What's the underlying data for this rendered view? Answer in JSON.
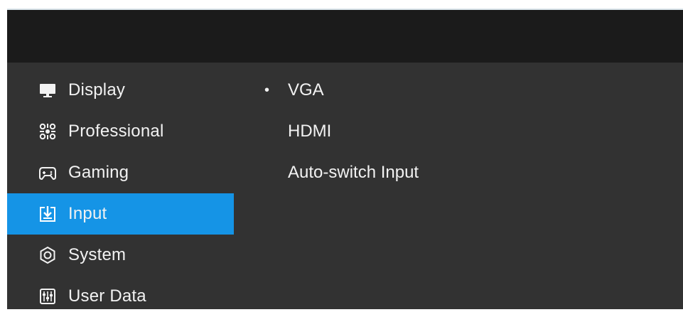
{
  "sidebar": {
    "items": [
      {
        "label": "Display",
        "icon": "monitor-icon"
      },
      {
        "label": "Professional",
        "icon": "professional-icon"
      },
      {
        "label": "Gaming",
        "icon": "gamepad-icon"
      },
      {
        "label": "Input",
        "icon": "input-icon",
        "active": true
      },
      {
        "label": "System",
        "icon": "system-icon"
      },
      {
        "label": "User Data",
        "icon": "user-data-icon"
      }
    ]
  },
  "options": {
    "selected_marker": "•",
    "items": [
      {
        "label": "VGA",
        "selected": true
      },
      {
        "label": "HDMI",
        "selected": false
      },
      {
        "label": "Auto-switch Input",
        "selected": false
      }
    ]
  },
  "colors": {
    "accent": "#1594e6",
    "panel": "#323232",
    "header": "#1b1b1b",
    "text": "#f2f2f2"
  }
}
